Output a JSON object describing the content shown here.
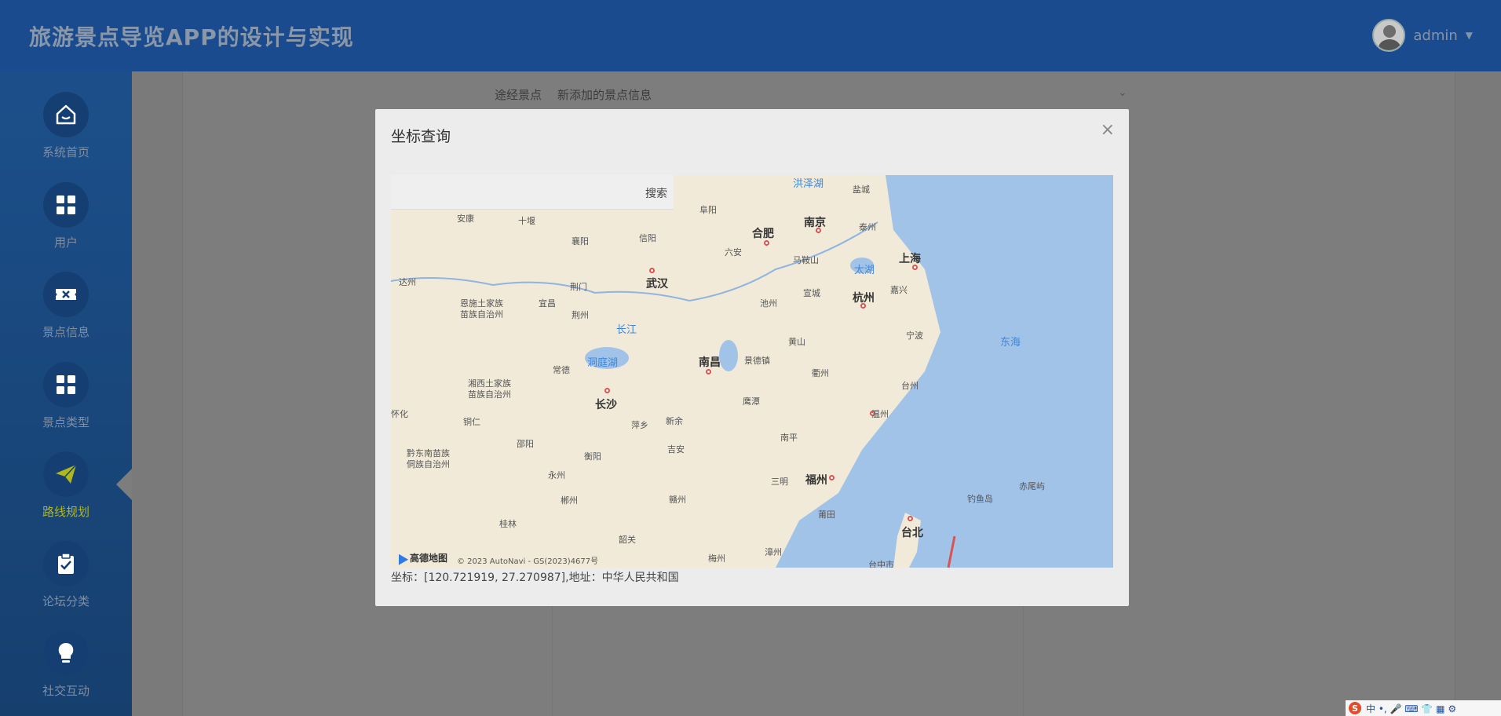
{
  "header": {
    "app_title": "旅游景点导览APP的设计与实现",
    "user_name": "admin",
    "caret": "▼"
  },
  "sidebar": {
    "items": [
      {
        "label": "系统首页",
        "icon": "home-icon",
        "active": false
      },
      {
        "label": "用户",
        "icon": "grid-icon",
        "active": false
      },
      {
        "label": "景点信息",
        "icon": "ticket-icon",
        "active": false
      },
      {
        "label": "景点类型",
        "icon": "grid-icon",
        "active": false
      },
      {
        "label": "路线规划",
        "icon": "paper-plane-icon",
        "active": true
      },
      {
        "label": "论坛分类",
        "icon": "clipboard-check-icon",
        "active": false
      },
      {
        "label": "社交互动",
        "icon": "lightbulb-icon",
        "active": false
      }
    ],
    "active_color": "#b0b71a"
  },
  "form": {
    "via_label": "途经景点",
    "via_value": "新添加的景点信息"
  },
  "modal": {
    "title": "坐标查询",
    "close": "×",
    "search_button": "搜索",
    "search_placeholder": "",
    "coord_text": "坐标：[120.721919, 27.270987],地址：中华人民共和国",
    "map_logo": "高德地图",
    "map_copyright": "© 2023 AutoNavi - GS(2023)4677号",
    "map_labels": {
      "big": [
        "武汉",
        "南京",
        "合肥",
        "上海",
        "杭州",
        "南昌",
        "长沙",
        "福州",
        "台北"
      ],
      "small": [
        "阜阳",
        "盐城",
        "安康",
        "十堰",
        "襄阳",
        "信阳",
        "六安",
        "泰州",
        "马鞍山",
        "达州",
        "荆门",
        "恩施土家族",
        "苗族自治州",
        "宜昌",
        "荆州",
        "池州",
        "宣城",
        "嘉兴",
        "宁波",
        "黄山",
        "景德镇",
        "衢州",
        "常德",
        "湘西土家族",
        "苗族自治州",
        "鹰潭",
        "台州",
        "温州",
        "萍乡",
        "新余",
        "铜仁",
        "邵阳",
        "衡阳",
        "吉安",
        "南平",
        "黔东南苗族",
        "侗族自治州",
        "永州",
        "三明",
        "赣州",
        "郴州",
        "莆田",
        "桂林",
        "韶关",
        "梅州",
        "漳州",
        "台中市",
        "钓鱼岛",
        "赤尾屿",
        "怀化"
      ],
      "water": [
        "洪泽湖",
        "太湖",
        "洞庭湖",
        "长江",
        "东海"
      ]
    }
  },
  "ime": {
    "logo": "S",
    "text": "中 •, 🎤 ⌨ 👕 ▦ ⚙"
  }
}
